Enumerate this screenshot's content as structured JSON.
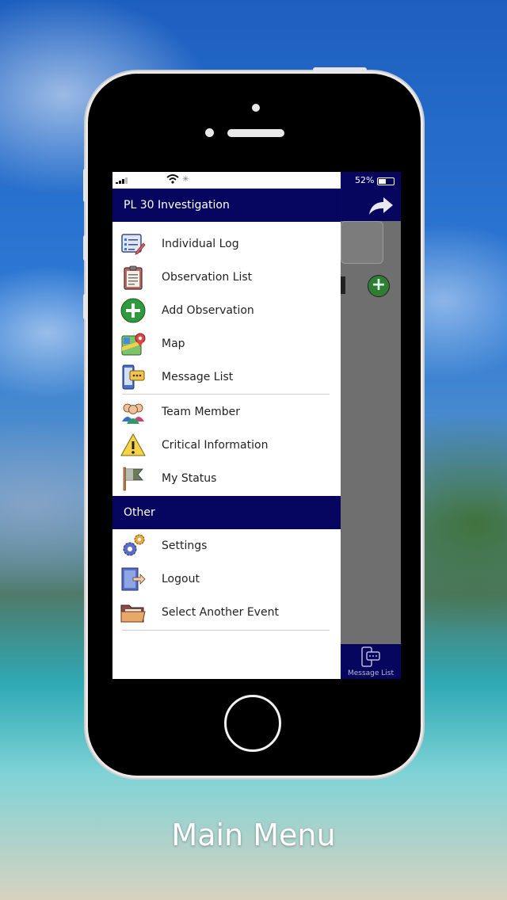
{
  "status_bar": {
    "battery_text": "52%"
  },
  "drawer": {
    "header_title": "PL 30 Investigation",
    "items": [
      {
        "label": "Individual Log",
        "icon": "individual-log-icon"
      },
      {
        "label": "Observation List",
        "icon": "clipboard-icon"
      },
      {
        "label": "Add Observation",
        "icon": "add-circle-icon"
      },
      {
        "label": "Map",
        "icon": "map-icon"
      },
      {
        "label": "Message List",
        "icon": "message-phone-icon"
      },
      {
        "label": "Team Member",
        "icon": "team-icon"
      },
      {
        "label": "Critical Information",
        "icon": "warning-icon"
      },
      {
        "label": "My Status",
        "icon": "flag-icon"
      }
    ],
    "other_header": "Other",
    "other_items": [
      {
        "label": "Settings",
        "icon": "gears-icon"
      },
      {
        "label": "Logout",
        "icon": "logout-icon"
      },
      {
        "label": "Select Another Event",
        "icon": "folder-icon"
      }
    ]
  },
  "background_app": {
    "bottom_tab_label": "Message List"
  },
  "caption": "Main Menu",
  "colors": {
    "header": "#05055f",
    "add_green": "#2e7d32"
  }
}
